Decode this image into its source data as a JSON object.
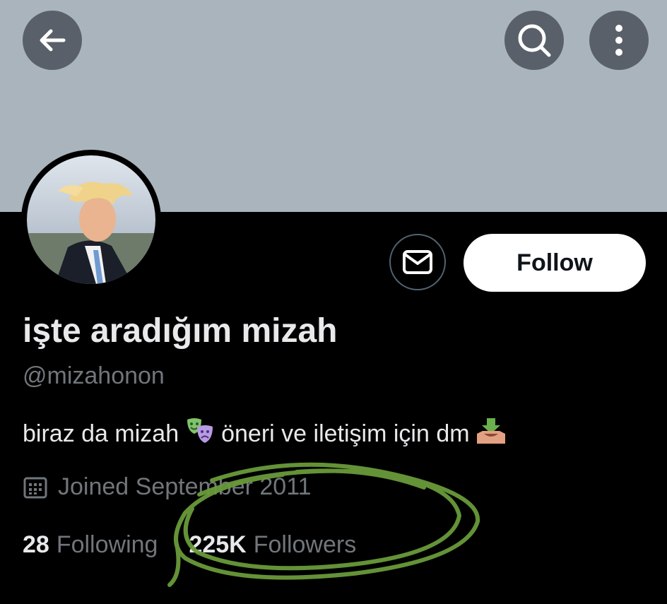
{
  "header": {
    "back_icon": "arrow-left-icon",
    "search_icon": "search-icon",
    "more_icon": "more-vertical-icon"
  },
  "profile": {
    "display_name": "işte aradığım mizah",
    "handle": "@mizahonon",
    "bio_part1": "biraz da mizah",
    "bio_emoji1": "performing-arts-emoji",
    "bio_part2": "öneri ve iletişim için dm",
    "bio_emoji2": "inbox-tray-emoji",
    "joined": "Joined September 2011",
    "following_count": "28",
    "following_label": "Following",
    "followers_count": "225K",
    "followers_label": "Followers"
  },
  "actions": {
    "message_icon": "mail-icon",
    "follow_label": "Follow"
  },
  "colors": {
    "banner": "#aab4bd",
    "background": "#000000",
    "text_primary": "#e7e9ea",
    "text_secondary": "#71767b",
    "annotation": "#6a9a3a"
  }
}
